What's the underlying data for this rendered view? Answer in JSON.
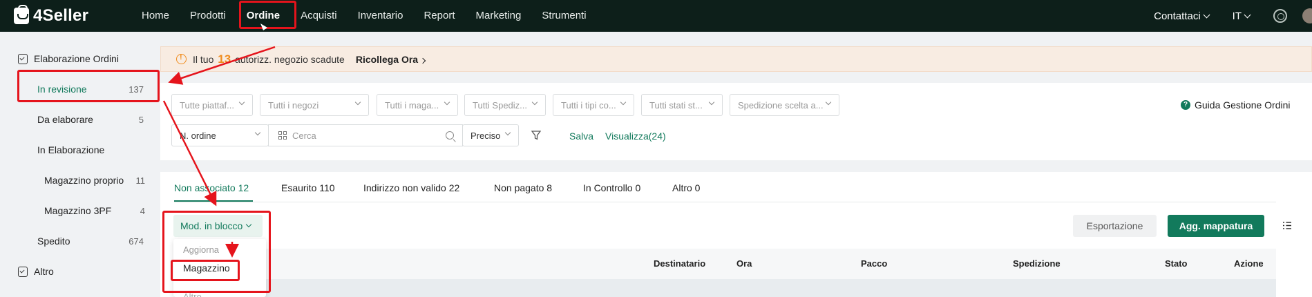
{
  "app": {
    "name": "4Seller"
  },
  "nav": {
    "items": [
      {
        "label": "Home"
      },
      {
        "label": "Prodotti"
      },
      {
        "label": "Ordine",
        "active": true
      },
      {
        "label": "Acquisti"
      },
      {
        "label": "Inventario"
      },
      {
        "label": "Report"
      },
      {
        "label": "Marketing"
      },
      {
        "label": "Strumenti"
      }
    ],
    "contact_label": "Contattaci",
    "language_label": "IT"
  },
  "sidebar": {
    "group1_label": "Elaborazione Ordini",
    "items": [
      {
        "label": "In revisione",
        "count": "137",
        "active": true
      },
      {
        "label": "Da elaborare",
        "count": "5"
      },
      {
        "label": "In Elaborazione",
        "count": ""
      },
      {
        "label": "Magazzino proprio",
        "count": "11"
      },
      {
        "label": "Magazzino 3PF",
        "count": "4"
      },
      {
        "label": "Spedito",
        "count": "674"
      }
    ],
    "group2_label": "Altro"
  },
  "alert": {
    "prefix": "Il tuo",
    "number": "13",
    "suffix": "autorizz. negozio scadute",
    "link": "Ricollega Ora"
  },
  "filters": {
    "selects": [
      "Tutte piattaf...",
      "Tutti i negozi",
      "Tutti i maga...",
      "Tutti Spediz...",
      "Tutti i tipi co...",
      "Tutti stati st...",
      "Spedizione scelta a..."
    ],
    "order_field": "N. ordine",
    "search_placeholder": "Cerca",
    "match_mode": "Preciso",
    "save_label": "Salva",
    "view_label": "Visualizza(24)",
    "guide_label": "Guida Gestione Ordini"
  },
  "tabs": [
    {
      "label": "Non associato 12",
      "active": true
    },
    {
      "label": "Esaurito 110"
    },
    {
      "label": "Indirizzo non valido 22"
    },
    {
      "label": "Non pagato 8"
    },
    {
      "label": "In Controllo 0"
    },
    {
      "label": "Altro 0"
    }
  ],
  "toolbar": {
    "bulk_label": "Mod. in blocco",
    "export_label": "Esportazione",
    "map_label": "Agg. mappatura"
  },
  "dropdown": {
    "header": "Aggiorna",
    "item": "Magazzino",
    "footer": "Altro"
  },
  "table": {
    "columns": [
      "Destinatario",
      "Ora",
      "Pacco",
      "Spedizione",
      "Stato",
      "Azione"
    ]
  },
  "colors": {
    "accent": "#127a5c",
    "annotation": "#e5141c",
    "warning": "#f08c1e"
  }
}
